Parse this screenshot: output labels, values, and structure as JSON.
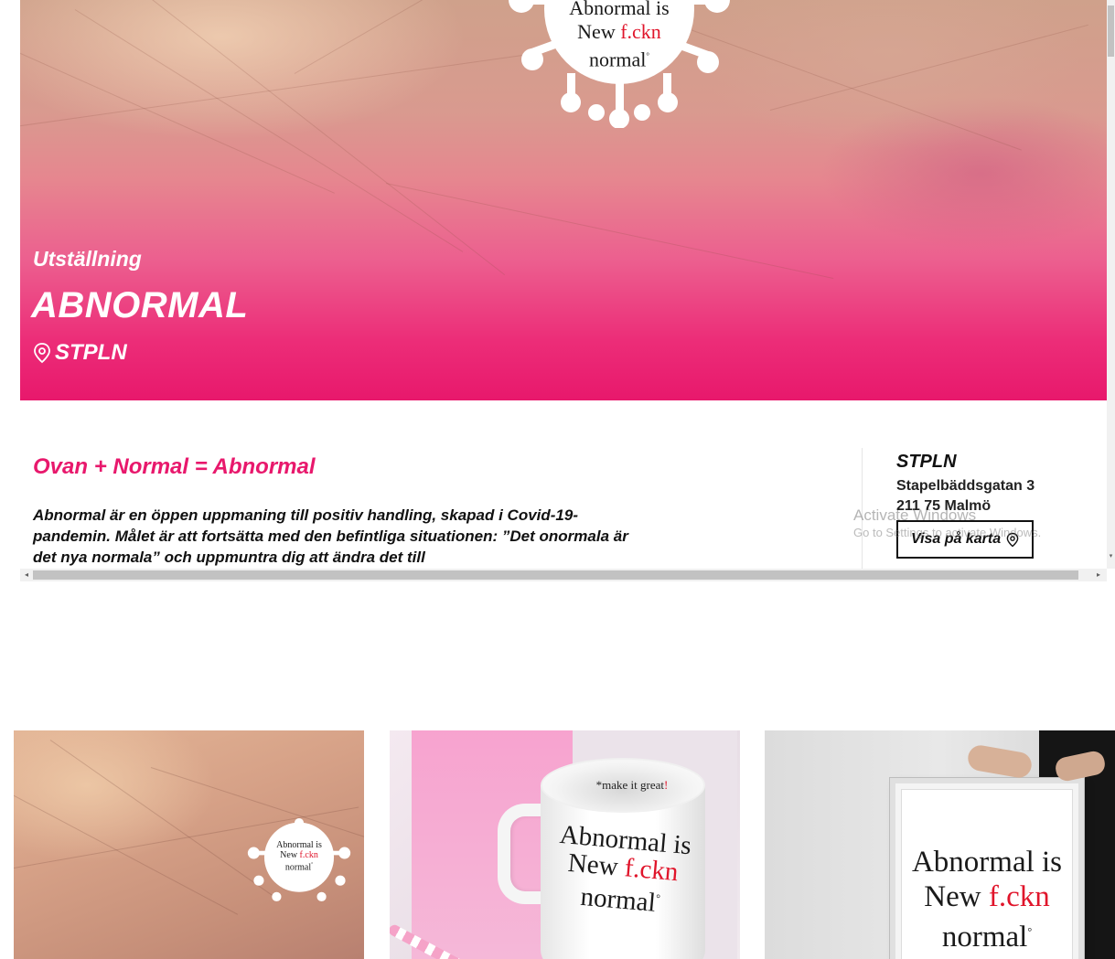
{
  "hero": {
    "kicker": "Utställning",
    "title": "ABNORMAL",
    "venue": "STPLN",
    "logo_line1": "Abnormal is",
    "logo_line2_a": "New ",
    "logo_line2_b": "f.ckn",
    "logo_line3": "normal"
  },
  "content": {
    "lead": "Ovan + Normal = Abnormal",
    "body": "Abnormal är en öppen uppmaning till positiv handling, skapad i Covid-19-pandemin. Målet är att fortsätta med den befintliga situationen: ”Det onormala är det nya normala” och uppmuntra dig att ändra det till"
  },
  "aside": {
    "name": "STPLN",
    "street": "Stapelbäddsgatan 3",
    "city": "211 75 Malmö",
    "map_button": "Visa på karta",
    "map_icon": "location-pin-icon"
  },
  "watermark": {
    "title": "Activate Windows",
    "subtitle": "Go to Settings to activate Windows."
  },
  "gallery": {
    "thumb1": {
      "line1": "Abnormal is",
      "line2_a": "New ",
      "line2_b": "f.ckn",
      "line3": "normal"
    },
    "thumb2": {
      "inner_a": "*make it great",
      "inner_b": "!",
      "line1": "Abnormal is",
      "line2_a": "New ",
      "line2_b": "f.ckn",
      "line3": "normal"
    },
    "thumb3": {
      "line1": "Abnormal is",
      "line2_a": "New ",
      "line2_b": "f.ckn",
      "line3": "normal"
    }
  },
  "colors": {
    "brand_pink": "#e8186c",
    "logo_red": "#e0152b"
  }
}
